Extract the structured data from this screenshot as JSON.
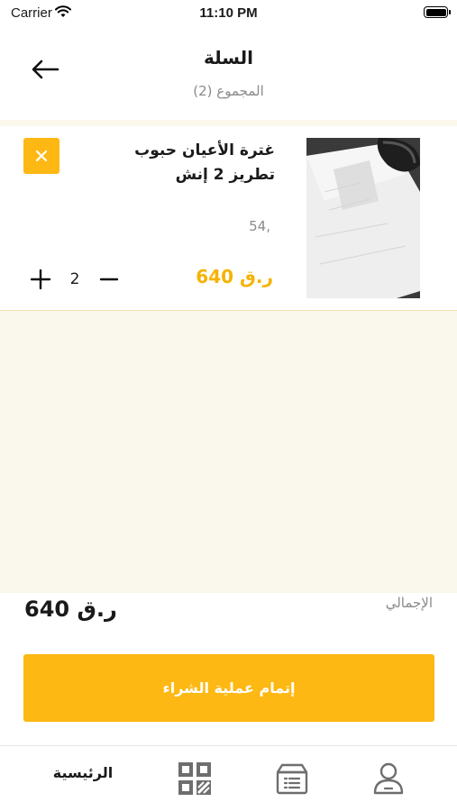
{
  "status_bar": {
    "carrier": "Carrier",
    "time": "11:10 PM"
  },
  "header": {
    "title": "السلة",
    "subtitle": "المجموع (2)"
  },
  "cart": {
    "items": [
      {
        "name": "غترة الأعيان حبوب تطريز 2 إنش",
        "spec": "54,",
        "price": "640 ر.ق",
        "quantity": "2"
      }
    ]
  },
  "summary": {
    "total_label": "الإجمالي",
    "total_value": "640 ر.ق"
  },
  "checkout": {
    "label": "إتمام عملية الشراء"
  },
  "bottom_nav": {
    "home_label": "الرئيسية",
    "icons": [
      "qr-code-icon",
      "orders-box-icon",
      "profile-icon"
    ]
  },
  "colors": {
    "accent": "#fdb813",
    "price": "#f5b301",
    "background": "#faf7ec",
    "muted_text": "#8a8a8a"
  }
}
